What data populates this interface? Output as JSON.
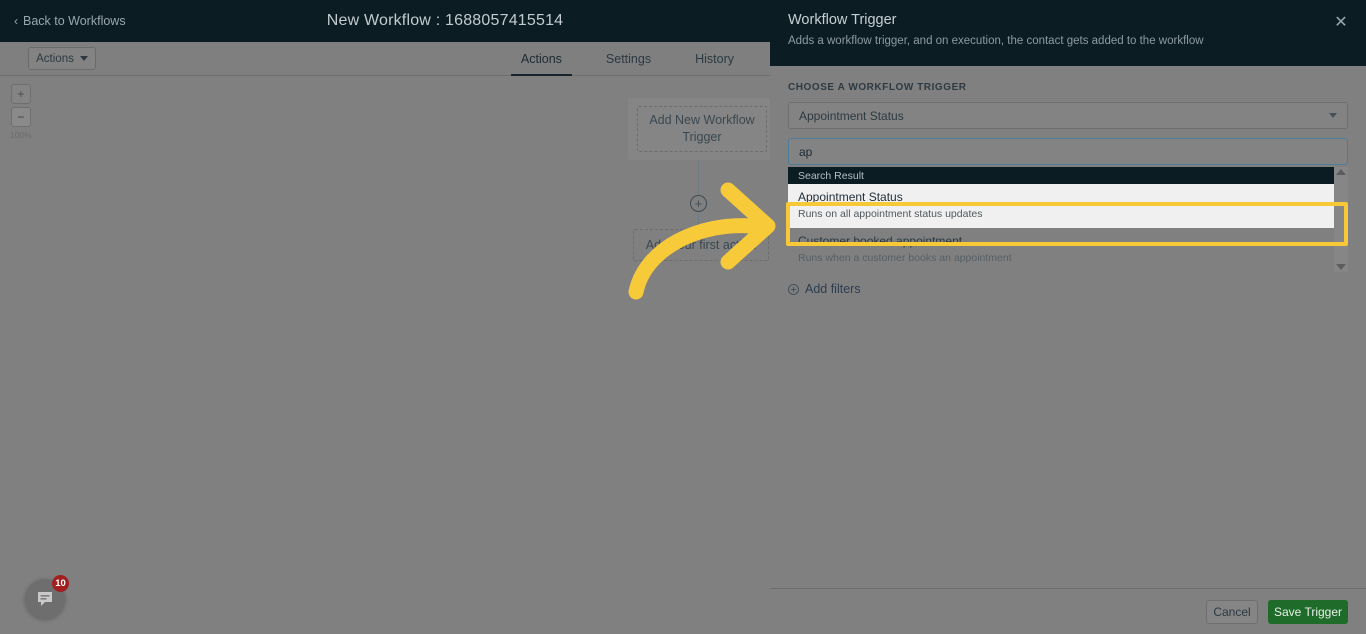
{
  "topbar": {
    "back_label": "Back to Workflows",
    "back_icon": "chevron-left-icon",
    "workflow_title": "New Workflow : 1688057415514",
    "close_icon": "close-icon"
  },
  "subbar": {
    "actions_button": "Actions",
    "caret_icon": "chevron-down-icon",
    "tabs": [
      {
        "label": "Actions",
        "active": true
      },
      {
        "label": "Settings",
        "active": false
      },
      {
        "label": "History",
        "active": false
      }
    ]
  },
  "canvas": {
    "zoom": {
      "zoom_in_icon": "plus-icon",
      "zoom_out_icon": "minus-icon",
      "level": "100%"
    },
    "trigger_node": "Add New Workflow Trigger",
    "add_node_icon": "plus-circle-icon",
    "action_node": "Add your first action",
    "chat": {
      "icon": "chat-bubble-icon",
      "badge": "10"
    }
  },
  "panel": {
    "title": "Workflow Trigger",
    "subtitle": "Adds a workflow trigger, and on execution, the contact gets added to the workflow",
    "close_icon": "close-icon",
    "field_label": "CHOOSE A WORKFLOW TRIGGER",
    "select": {
      "value": "Appointment Status",
      "caret_icon": "chevron-down-icon"
    },
    "search": {
      "value": "ap",
      "placeholder": ""
    },
    "dropdown": {
      "header": "Search Result",
      "scroll_up_icon": "triangle-up-icon",
      "scroll_down_icon": "triangle-down-icon",
      "items": [
        {
          "title": "Appointment Status",
          "desc": "Runs on all appointment status updates",
          "selected": true
        },
        {
          "title": "Customer booked appointment",
          "desc": "Runs when a customer books an appointment",
          "selected": false
        }
      ]
    },
    "add_filters": {
      "label": "Add filters",
      "icon": "plus-circle-icon"
    },
    "footer": {
      "cancel": "Cancel",
      "save": "Save Trigger"
    }
  },
  "annotation": {
    "arrow_color": "#f7ca3a",
    "highlight_color": "#f7c938"
  }
}
